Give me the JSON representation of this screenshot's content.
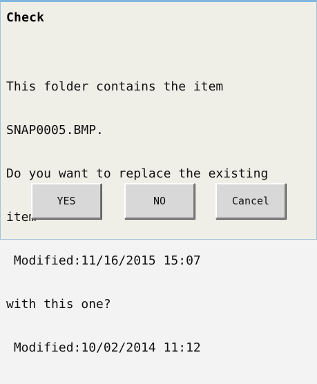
{
  "dialog": {
    "title": "Check",
    "message_lines": [
      "This folder contains the item",
      "SNAP0005.BMP.",
      "Do you want to replace the existing",
      "item",
      " Modified:11/16/2015 15:07",
      "with this one?",
      " Modified:10/02/2014 11:12"
    ],
    "buttons": {
      "yes": "YES",
      "no": "NO",
      "cancel": "Cancel"
    }
  },
  "colors": {
    "background": "#f0efe7",
    "top_border": "#7fb7df",
    "button_face": "#d8d8d8"
  }
}
